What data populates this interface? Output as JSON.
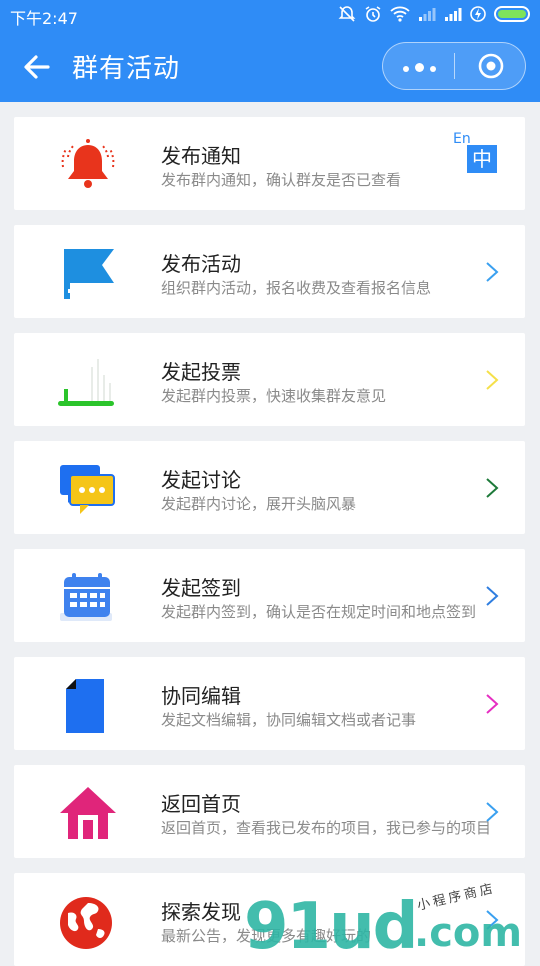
{
  "status_bar": {
    "time": "下午2:47"
  },
  "nav": {
    "title": "群有活动"
  },
  "translate_badge": {
    "en": "En",
    "zh": "中"
  },
  "items": [
    {
      "title": "发布通知",
      "desc": "发布群内通知，确认群友是否已查看",
      "icon": "bell-icon",
      "icon_color": "#e8341c",
      "chevron_color": null
    },
    {
      "title": "发布活动",
      "desc": "组织群内活动，报名收费及查看报名信息",
      "icon": "flag-icon",
      "icon_color": "#1e8fe0",
      "chevron_color": "#3aa0f0"
    },
    {
      "title": "发起投票",
      "desc": "发起群内投票，快速收集群友意见",
      "icon": "vote-icon",
      "icon_color": "#2bc42b",
      "chevron_color": "#f5e04a"
    },
    {
      "title": "发起讨论",
      "desc": "发起群内讨论，展开头脑风暴",
      "icon": "chat-bubbles-icon",
      "icon_color": "#f5c518",
      "chevron_color": "#1e7a3a"
    },
    {
      "title": "发起签到",
      "desc": "发起群内签到，确认是否在规定时间和地点签到",
      "icon": "calendar-icon",
      "icon_color": "#3f82ee",
      "chevron_color": "#2f7ee0"
    },
    {
      "title": "协同编辑",
      "desc": "发起文档编辑，协同编辑文档或者记事",
      "icon": "document-icon",
      "icon_color": "#1e6ff0",
      "chevron_color": "#e62ec2"
    },
    {
      "title": "返回首页",
      "desc": "返回首页，查看我已发布的项目，我已参与的项目",
      "icon": "home-icon",
      "icon_color": "#e0257a",
      "chevron_color": "#3aa0f0"
    },
    {
      "title": "探索发现",
      "desc": "最新公告，发现更多有趣好玩的",
      "icon": "globe-icon",
      "icon_color": "#e02a1c",
      "chevron_color": "#3aa0f0"
    }
  ],
  "watermark": {
    "main": "91ud",
    "domain": ".com",
    "script": "小程序商店"
  }
}
